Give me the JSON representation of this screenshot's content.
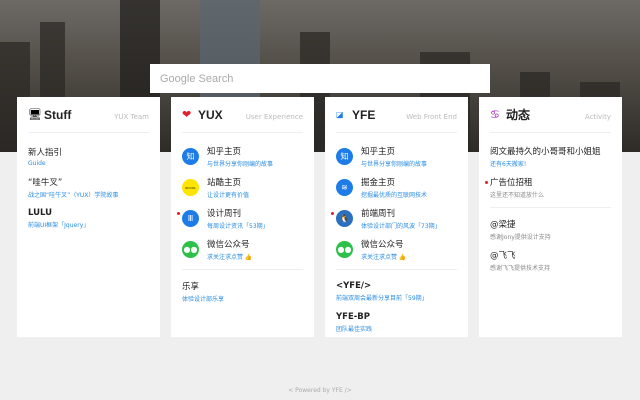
{
  "search": {
    "placeholder": "Google Search"
  },
  "cards": [
    {
      "title": "Stuff",
      "subtitle": "YUX Team",
      "icon": "monitor-icon",
      "items": [
        {
          "title": "新人指引",
          "desc": "Guide"
        },
        {
          "title": "“哇牛叉”",
          "desc": "战之国“哇牛叉”（YUX）学院故事"
        },
        {
          "title": "LULU",
          "desc": "前端UI框架「Jquery」"
        }
      ]
    },
    {
      "title": "YUX",
      "subtitle": "User Experience",
      "icon": "heart-icon",
      "items": [
        {
          "title": "知乎主页",
          "desc": "与世界分享你刚编的故事",
          "icon": "知"
        },
        {
          "title": "站酷主页",
          "desc": "让设计更有价值",
          "icon": "ZCOOL"
        },
        {
          "title": "设计周刊",
          "desc": "每周设计资讯「53期」",
          "icon": "Ⅲ"
        },
        {
          "title": "微信公众号",
          "desc": "求关注求点赞 👍",
          "icon": "wechat"
        },
        {
          "title": "乐享",
          "desc": "体验设计部乐享"
        }
      ]
    },
    {
      "title": "YFE",
      "subtitle": "Web Front End",
      "icon": "yfe-logo-icon",
      "items": [
        {
          "title": "知乎主页",
          "desc": "与世界分享你刚编的故事",
          "icon": "知"
        },
        {
          "title": "掘金主页",
          "desc": "挖掘最优质的互联网技术",
          "icon": "≋"
        },
        {
          "title": "前端周刊",
          "desc": "体验设计部门的风波「73期」",
          "icon": "qq"
        },
        {
          "title": "微信公众号",
          "desc": "求关注求点赞 👍",
          "icon": "wechat"
        },
        {
          "title": "<YFE/>",
          "desc": "前端双周会最新分享目前「59期」"
        },
        {
          "title": "YFE-BP",
          "desc": "团队最佳实践"
        },
        {
          "title": "v-tools",
          "desc": ""
        }
      ]
    },
    {
      "title": "动态",
      "subtitle": "Activity",
      "icon": "activity-icon",
      "items": [
        {
          "title": "阅文最持久的小哥哥和小姐姐",
          "desc": "还有6天搬家!"
        },
        {
          "title": "广告位招租",
          "desc": "这里还不知道放什么"
        },
        {
          "title": "@梁捷",
          "desc": "感谢Jony提供设计支持"
        },
        {
          "title": "@飞飞",
          "desc": "感谢飞飞提供技术支持"
        }
      ]
    }
  ],
  "footer": "< Powered by YFE />"
}
